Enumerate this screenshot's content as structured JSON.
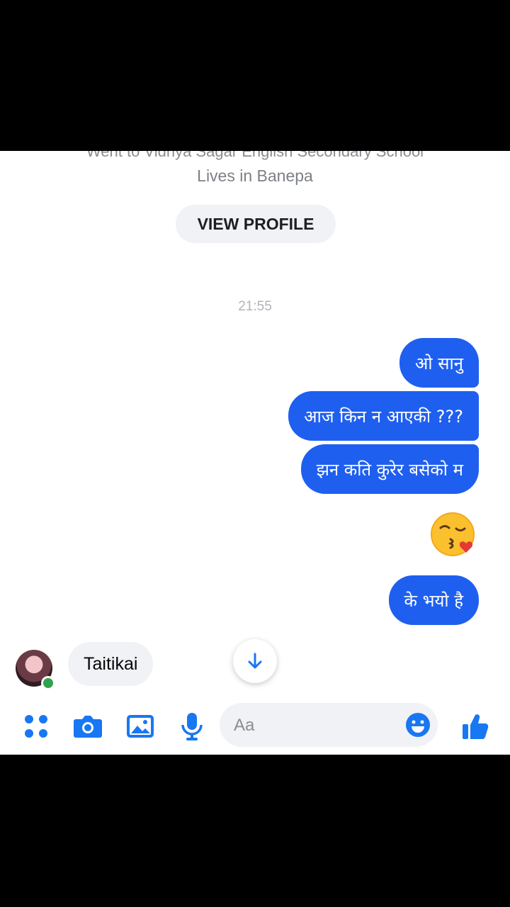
{
  "profile": {
    "school_line": "Went to Vidhya Sagar English Secondary School",
    "lives": "Lives in Banepa",
    "view_profile": "VIEW PROFILE"
  },
  "timestamp": "21:55",
  "messages_sent": [
    {
      "text": "ओ सानु"
    },
    {
      "text": "आज किन न आएकी ???"
    },
    {
      "text": "झन कति कुरेर बसेको म"
    },
    {
      "emoji": "face-blowing-kiss"
    },
    {
      "text": "के भयो है"
    }
  ],
  "message_received": {
    "text": "Taitikai"
  },
  "composer": {
    "placeholder": "Aa"
  },
  "colors": {
    "sent_bubble": "#1f5ff0",
    "accent": "#1877f2",
    "received_bubble": "#f0f2f5",
    "online": "#31a24c"
  },
  "icons": [
    "menu-dots-icon",
    "camera-icon",
    "gallery-icon",
    "microphone-icon",
    "smile-icon",
    "like-icon",
    "arrow-down-icon"
  ]
}
